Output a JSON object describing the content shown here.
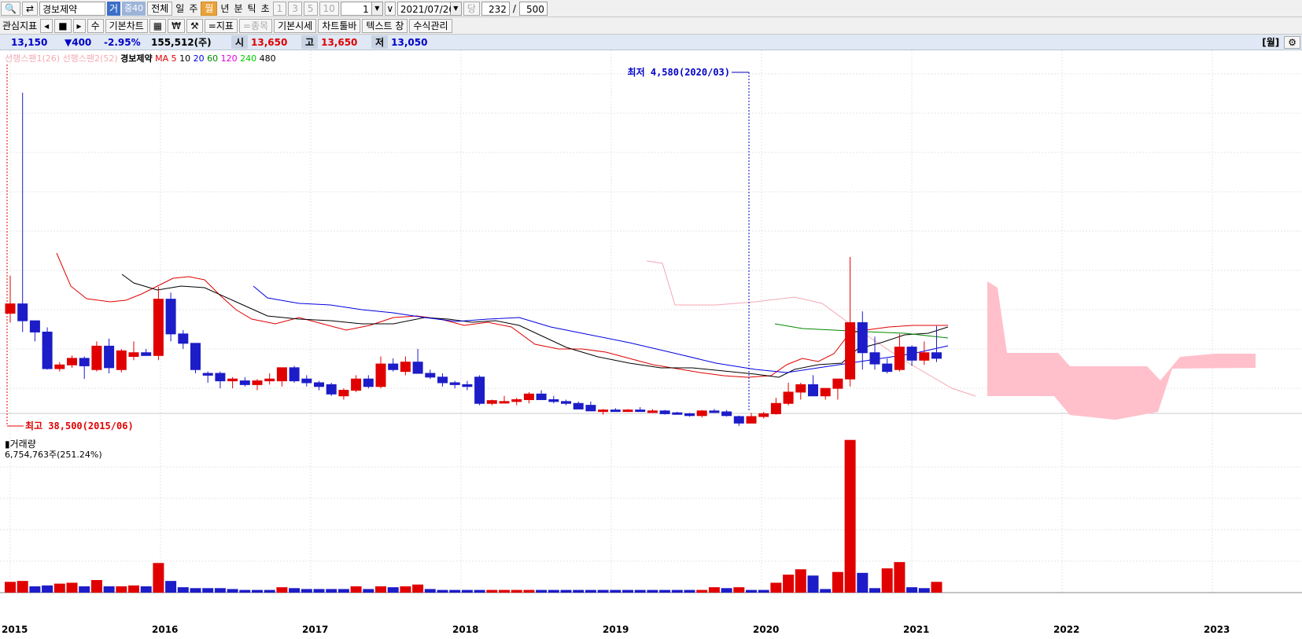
{
  "toolbar1": {
    "stock_name": "경보제약",
    "tag_ge": "거",
    "tag_jung": "중40",
    "periods": [
      "전체",
      "일",
      "주",
      "월",
      "년",
      "분",
      "틱",
      "초"
    ],
    "selected_period": "월",
    "num_buttons": [
      "1",
      "3",
      "5",
      "10"
    ],
    "count_value": "1",
    "date_value": "2021/07/26",
    "dang_label": "당",
    "display_count": "232",
    "slash": "/",
    "total_count": "500"
  },
  "toolbar2": {
    "interest_label": "관심지표",
    "nav_prev": "◂",
    "nav_stop": "■",
    "nav_next": "▸",
    "su_label": "수",
    "basic_chart": "기본차트",
    "won_label": "₩",
    "indicator": "=지표",
    "item": "=종목",
    "basic_quote": "기본시세",
    "chart_toolbar": "차트툴바",
    "text_label": "텍스트 창",
    "formula": "수식관리"
  },
  "quote": {
    "price": "13,150",
    "change": "▼400",
    "change_pct": "-2.95%",
    "volume": "155,512(주)",
    "open_label": "시",
    "open": "13,650",
    "high_label": "고",
    "high": "13,650",
    "low_label": "저",
    "low": "13,050",
    "period_tag": "[월]"
  },
  "legend": {
    "span1": "선행스팬1(26)",
    "span2": "선행스팬2(52)",
    "name": "경보제약",
    "ma_label": "MA",
    "ma_periods": [
      "5",
      "10",
      "20",
      "60",
      "120",
      "240",
      "480"
    ],
    "ma_colors": [
      "#e00000",
      "#000000",
      "#0000e0",
      "#008800",
      "#e000e0",
      "#00cc00",
      "#000000"
    ]
  },
  "annotations": {
    "high_note": "최고 38,500(2015/06)",
    "low_note": "최저 4,580(2020/03)"
  },
  "volume_panel": {
    "label": "거래량",
    "value": "6,754,763주(251.24%)"
  },
  "colors": {
    "up": "#e00000",
    "down": "#1c1cc8",
    "cloud": "#ffc0cb",
    "selected": "#e9a23b"
  },
  "chart_data": {
    "type": "candlestick",
    "period": "monthly",
    "x_labels": [
      "2015",
      "2016",
      "2017",
      "2018",
      "2019",
      "2020",
      "2021",
      "2022",
      "2023"
    ],
    "price_range": [
      4500,
      41500
    ],
    "candles": [
      [
        1,
        "2015-05",
        15000,
        19000,
        14000,
        16000
      ],
      [
        2,
        "2015-06",
        16000,
        38500,
        13000,
        14200
      ],
      [
        3,
        "2015-07",
        14200,
        14200,
        12000,
        13000
      ],
      [
        4,
        "2015-08",
        13000,
        13500,
        9000,
        9100
      ],
      [
        5,
        "2015-09",
        9100,
        9800,
        8800,
        9500
      ],
      [
        6,
        "2015-10",
        9500,
        10500,
        9200,
        10200
      ],
      [
        7,
        "2015-11",
        10200,
        10400,
        8000,
        9400
      ],
      [
        8,
        "2015-12",
        9000,
        12000,
        8800,
        11500
      ],
      [
        9,
        "2016-01",
        11500,
        12300,
        8600,
        9200
      ],
      [
        10,
        "2016-02",
        9000,
        11200,
        8700,
        11000
      ],
      [
        11,
        "2016-03",
        10400,
        12000,
        10000,
        10800
      ],
      [
        12,
        "2016-04",
        10800,
        11200,
        10500,
        10500
      ],
      [
        13,
        "2016-05",
        10500,
        17800,
        10000,
        16500
      ],
      [
        14,
        "2016-06",
        16500,
        17200,
        12000,
        12800
      ],
      [
        15,
        "2016-07",
        12800,
        13200,
        11200,
        11800
      ],
      [
        16,
        "2016-08",
        11800,
        11800,
        8600,
        9000
      ],
      [
        17,
        "2016-09",
        8600,
        8800,
        7600,
        8400
      ],
      [
        18,
        "2016-10",
        8600,
        8800,
        7000,
        7800
      ],
      [
        19,
        "2016-11",
        7800,
        8200,
        7000,
        8000
      ],
      [
        20,
        "2016-12",
        7800,
        8200,
        7200,
        7400
      ],
      [
        21,
        "2016-13",
        7400,
        8000,
        6800,
        7800
      ],
      [
        22,
        "2017-01",
        7800,
        8600,
        7400,
        8000
      ],
      [
        23,
        "2017-02",
        7800,
        8600,
        7200,
        9200
      ],
      [
        24,
        "2017-03",
        9200,
        9400,
        7600,
        7800
      ],
      [
        25,
        "2017-04",
        8000,
        8400,
        7200,
        7600
      ],
      [
        26,
        "2017-05",
        7600,
        7800,
        6800,
        7200
      ],
      [
        27,
        "2017-06",
        7400,
        7600,
        6200,
        6400
      ],
      [
        28,
        "2017-07",
        6200,
        7000,
        5800,
        6800
      ],
      [
        29,
        "2017-08",
        6800,
        8400,
        6600,
        8000
      ],
      [
        30,
        "2017-09",
        8000,
        8400,
        7000,
        7200
      ],
      [
        31,
        "2017-10",
        7200,
        10400,
        7000,
        9600
      ],
      [
        32,
        "2017-11",
        9600,
        10200,
        8800,
        9000
      ],
      [
        33,
        "2017-12",
        8800,
        10400,
        8400,
        9800
      ],
      [
        34,
        "2018-01",
        9800,
        11200,
        9000,
        8600
      ],
      [
        35,
        "2018-02",
        8600,
        9000,
        8000,
        8200
      ],
      [
        36,
        "2018-03",
        8200,
        8600,
        7200,
        7600
      ],
      [
        37,
        "2018-04",
        7600,
        7800,
        7000,
        7400
      ],
      [
        38,
        "2018-05",
        7400,
        7800,
        6800,
        7200
      ],
      [
        39,
        "2018-06",
        8200,
        8400,
        5200,
        5400
      ],
      [
        40,
        "2018-07",
        5400,
        5800,
        5200,
        5700
      ],
      [
        41,
        "2018-08",
        5600,
        6200,
        5400,
        5600
      ],
      [
        42,
        "2018-09",
        5600,
        6000,
        5200,
        5800
      ],
      [
        43,
        "2018-10",
        5800,
        6600,
        5400,
        6400
      ],
      [
        44,
        "2018-11",
        6400,
        6800,
        5800,
        5800
      ],
      [
        45,
        "2018-12",
        5800,
        6200,
        5400,
        5600
      ],
      [
        46,
        "2019-01",
        5600,
        5800,
        5200,
        5400
      ],
      [
        47,
        "2019-02",
        5400,
        5600,
        5000,
        4800
      ],
      [
        48,
        "2019-03",
        5200,
        5600,
        4800,
        4600
      ],
      [
        49,
        "2019-04",
        4600,
        4800,
        4200,
        4700
      ],
      [
        50,
        "2019-05",
        4700,
        4900,
        4500,
        4650
      ],
      [
        51,
        "2019-06",
        4650,
        4800,
        4500,
        4700
      ],
      [
        52,
        "2019-07",
        4700,
        5000,
        4500,
        4550
      ],
      [
        53,
        "2019-08",
        4550,
        4800,
        4400,
        4600
      ],
      [
        54,
        "2019-09",
        4600,
        4700,
        4200,
        4300
      ],
      [
        55,
        "2019-10",
        4400,
        4500,
        4200,
        4300
      ],
      [
        56,
        "2019-11",
        4300,
        4400,
        4000,
        4100
      ],
      [
        57,
        "2019-12",
        4100,
        4700,
        3900,
        4600
      ],
      [
        58,
        "2020-01",
        4600,
        4800,
        4400,
        4500
      ],
      [
        59,
        "2020-02",
        4500,
        4700,
        4000,
        4100
      ],
      [
        60,
        "2020-03",
        4000,
        4100,
        3000,
        3300
      ],
      [
        61,
        "2020-04",
        3300,
        4400,
        3300,
        4000
      ],
      [
        62,
        "2020-05",
        4000,
        4500,
        3800,
        4300
      ],
      [
        63,
        "2020-06",
        4300,
        6000,
        4200,
        5400
      ],
      [
        64,
        "2020-07",
        5400,
        7600,
        5200,
        6600
      ],
      [
        65,
        "2020-08",
        6600,
        7600,
        5800,
        7400
      ],
      [
        66,
        "2020-09",
        7400,
        8400,
        6600,
        6200
      ],
      [
        67,
        "2020-10",
        6200,
        7000,
        5800,
        7000
      ],
      [
        68,
        "2020-11",
        7000,
        7600,
        5800,
        8000
      ],
      [
        69,
        "2020-12",
        8000,
        21000,
        7200,
        14000
      ],
      [
        70,
        "2021-01",
        14000,
        15200,
        9000,
        10800
      ],
      [
        71,
        "2021-02",
        10800,
        12500,
        9000,
        9600
      ],
      [
        72,
        "2021-03",
        9600,
        10200,
        8600,
        8800
      ],
      [
        73,
        "2021-04",
        9000,
        12800,
        8800,
        11400
      ],
      [
        74,
        "2021-05",
        11400,
        11600,
        9400,
        10000
      ],
      [
        75,
        "2021-06",
        10000,
        12000,
        9500,
        10800
      ],
      [
        76,
        "2021-07",
        10800,
        13650,
        9800,
        10200
      ]
    ],
    "volumes": [
      [
        1,
        1.2,
        "up"
      ],
      [
        2,
        1.3,
        "up"
      ],
      [
        3,
        0.7,
        "down"
      ],
      [
        4,
        0.8,
        "down"
      ],
      [
        5,
        1.0,
        "up"
      ],
      [
        6,
        1.1,
        "up"
      ],
      [
        7,
        0.7,
        "down"
      ],
      [
        8,
        1.4,
        "up"
      ],
      [
        9,
        0.7,
        "down"
      ],
      [
        10,
        0.7,
        "up"
      ],
      [
        11,
        0.8,
        "up"
      ],
      [
        12,
        0.7,
        "down"
      ],
      [
        13,
        3.3,
        "up"
      ],
      [
        14,
        1.3,
        "down"
      ],
      [
        15,
        0.6,
        "down"
      ],
      [
        16,
        0.5,
        "down"
      ],
      [
        17,
        0.5,
        "down"
      ],
      [
        18,
        0.5,
        "down"
      ],
      [
        19,
        0.4,
        "down"
      ],
      [
        20,
        0.3,
        "down"
      ],
      [
        21,
        0.3,
        "down"
      ],
      [
        22,
        0.3,
        "down"
      ],
      [
        23,
        0.6,
        "up"
      ],
      [
        24,
        0.5,
        "down"
      ],
      [
        25,
        0.4,
        "down"
      ],
      [
        26,
        0.4,
        "down"
      ],
      [
        27,
        0.4,
        "down"
      ],
      [
        28,
        0.4,
        "down"
      ],
      [
        29,
        0.7,
        "up"
      ],
      [
        30,
        0.4,
        "down"
      ],
      [
        31,
        0.7,
        "up"
      ],
      [
        32,
        0.6,
        "down"
      ],
      [
        33,
        0.7,
        "up"
      ],
      [
        34,
        0.9,
        "up"
      ],
      [
        35,
        0.4,
        "down"
      ],
      [
        36,
        0.3,
        "down"
      ],
      [
        37,
        0.3,
        "down"
      ],
      [
        38,
        0.3,
        "down"
      ],
      [
        39,
        0.3,
        "down"
      ],
      [
        40,
        0.3,
        "up"
      ],
      [
        41,
        0.3,
        "up"
      ],
      [
        42,
        0.3,
        "up"
      ],
      [
        43,
        0.3,
        "up"
      ],
      [
        44,
        0.3,
        "down"
      ],
      [
        45,
        0.3,
        "down"
      ],
      [
        46,
        0.3,
        "down"
      ],
      [
        47,
        0.3,
        "down"
      ],
      [
        48,
        0.3,
        "down"
      ],
      [
        49,
        0.3,
        "down"
      ],
      [
        50,
        0.3,
        "down"
      ],
      [
        51,
        0.3,
        "down"
      ],
      [
        52,
        0.3,
        "down"
      ],
      [
        53,
        0.3,
        "down"
      ],
      [
        54,
        0.3,
        "down"
      ],
      [
        55,
        0.3,
        "down"
      ],
      [
        56,
        0.3,
        "down"
      ],
      [
        57,
        0.3,
        "up"
      ],
      [
        58,
        0.6,
        "up"
      ],
      [
        59,
        0.5,
        "down"
      ],
      [
        60,
        0.6,
        "up"
      ],
      [
        61,
        0.3,
        "down"
      ],
      [
        62,
        0.3,
        "down"
      ],
      [
        63,
        1.1,
        "up"
      ],
      [
        64,
        2.0,
        "up"
      ],
      [
        65,
        2.6,
        "up"
      ],
      [
        66,
        1.9,
        "down"
      ],
      [
        67,
        0.4,
        "down"
      ],
      [
        68,
        2.3,
        "up"
      ],
      [
        69,
        17.0,
        "up"
      ],
      [
        70,
        2.2,
        "down"
      ],
      [
        71,
        0.5,
        "down"
      ],
      [
        72,
        2.7,
        "up"
      ],
      [
        73,
        3.4,
        "up"
      ],
      [
        74,
        0.6,
        "down"
      ],
      [
        75,
        0.5,
        "down"
      ],
      [
        76,
        1.2,
        "up"
      ]
    ],
    "volume_range": [
      0,
      17.5
    ]
  }
}
